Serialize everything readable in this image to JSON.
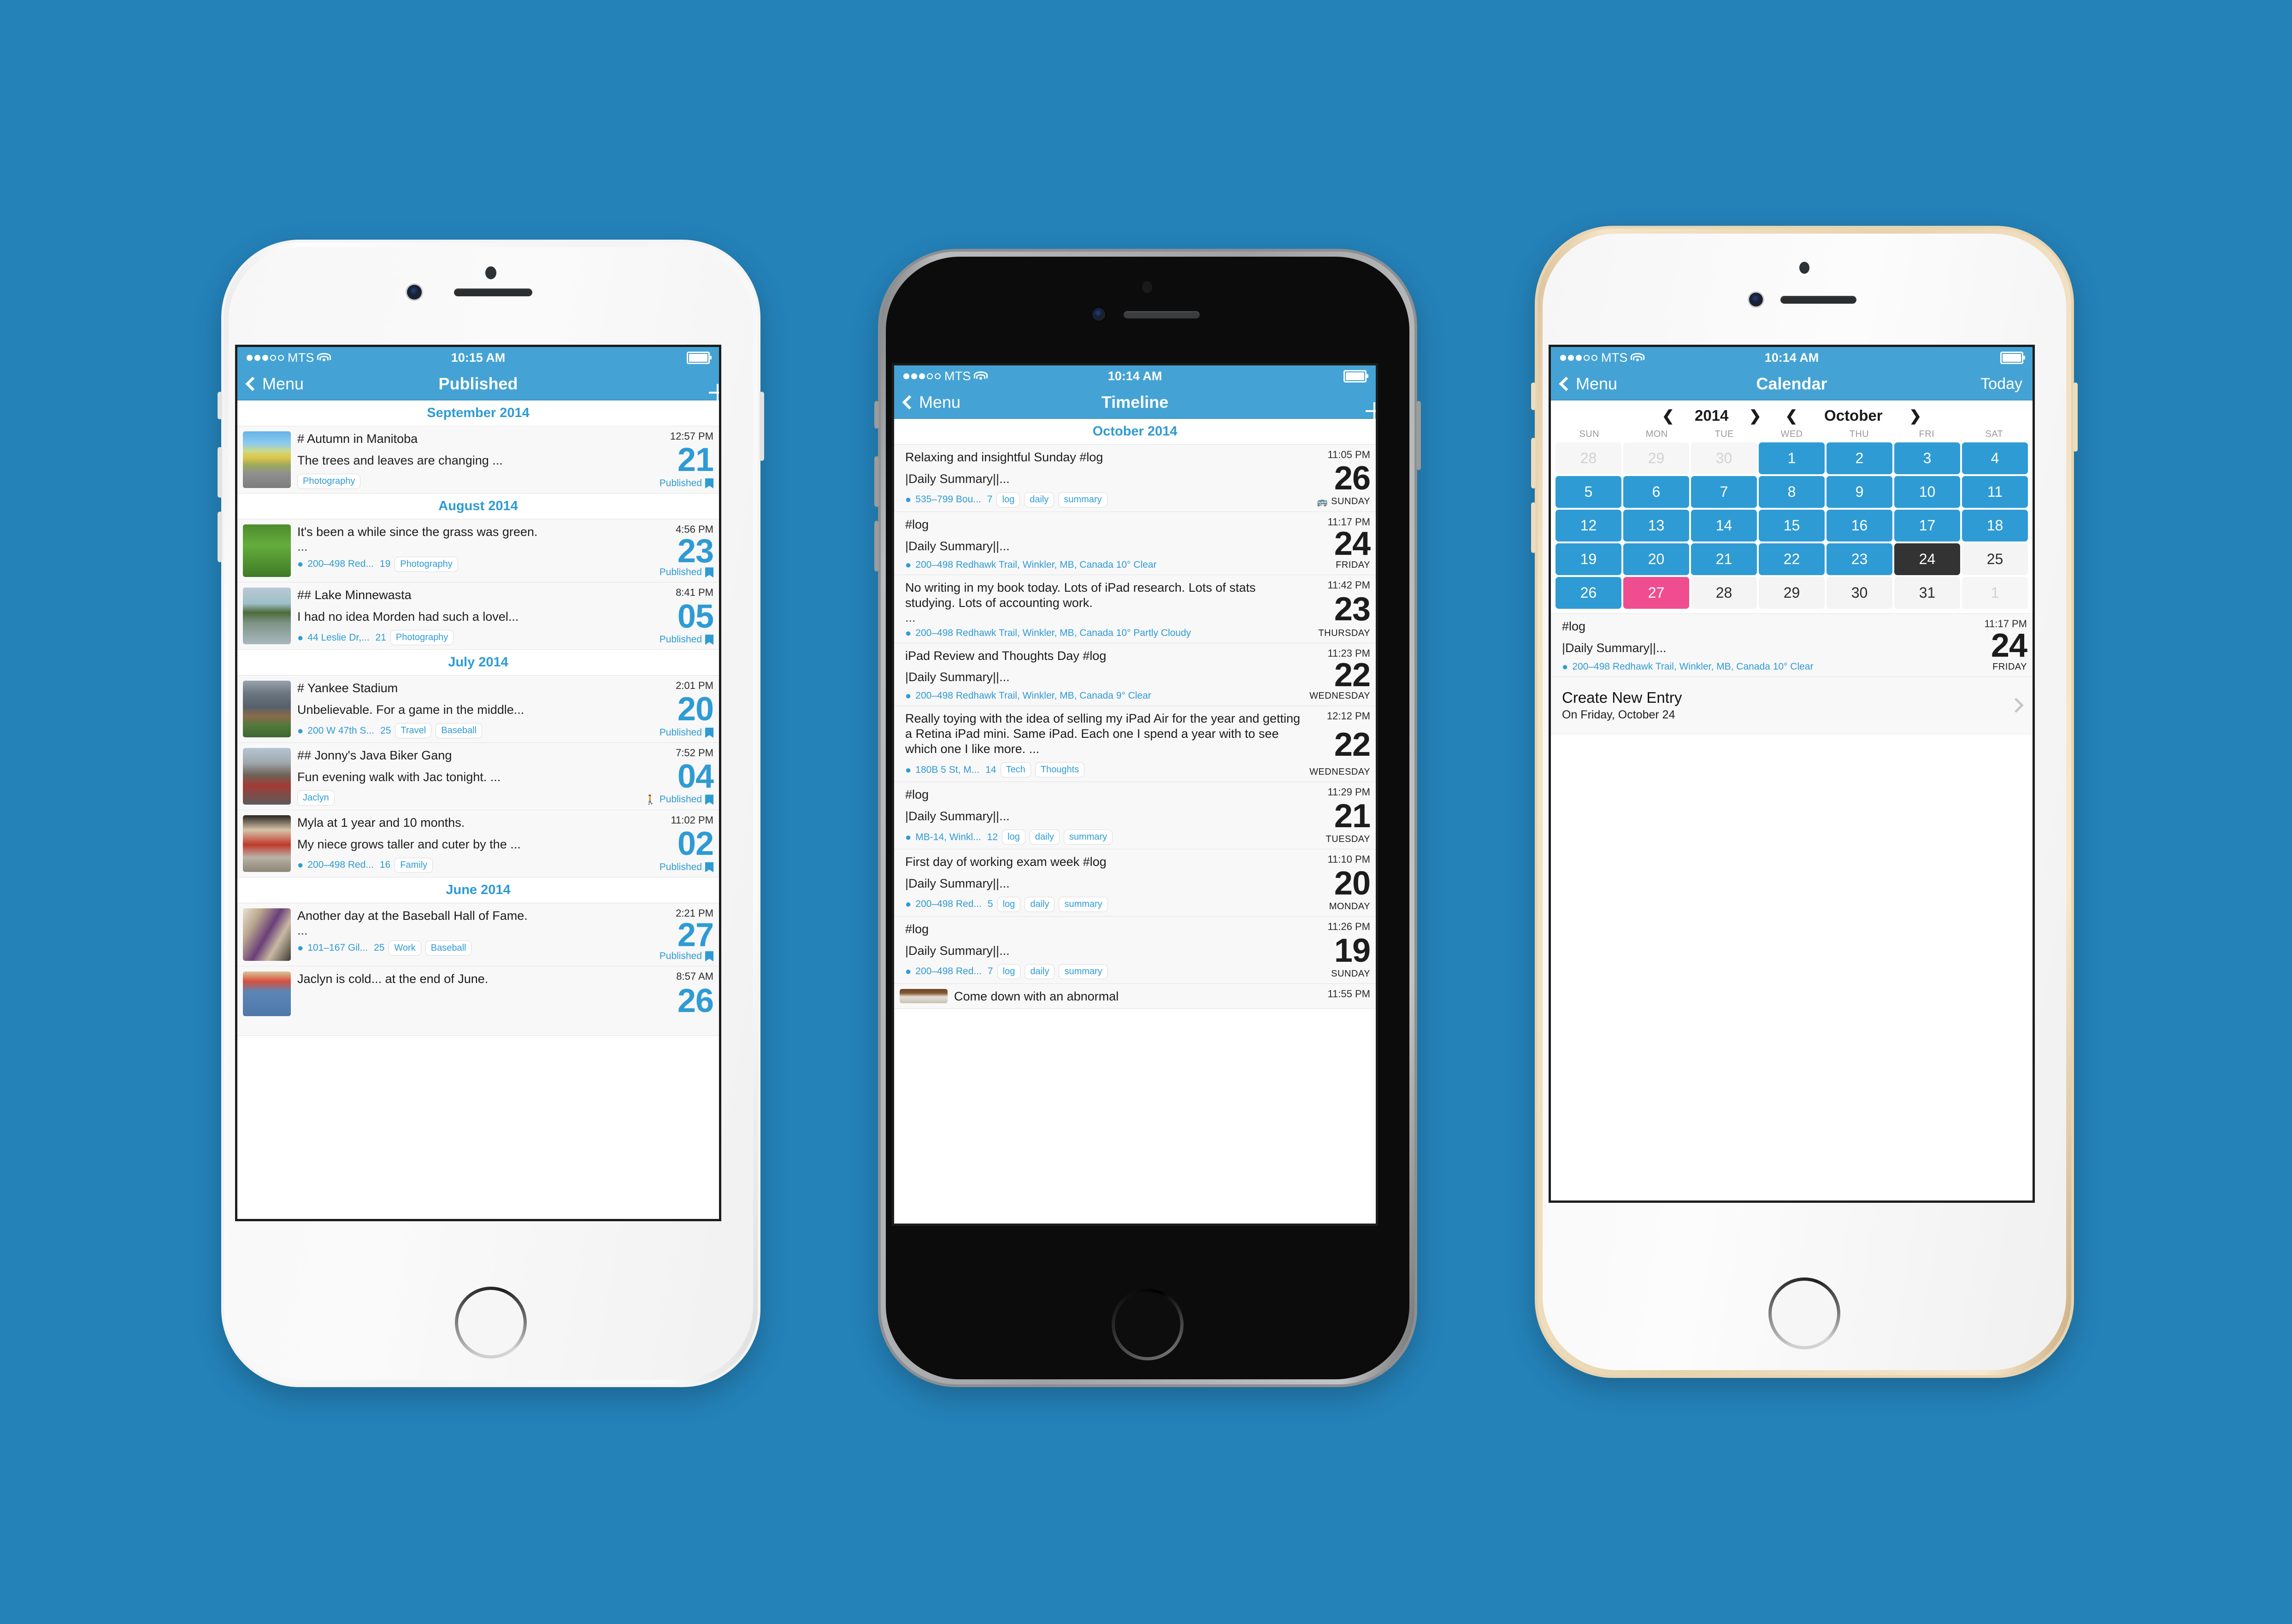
{
  "background_color": "#2482b9",
  "accent_color": "#2e9bd4",
  "phones": [
    {
      "id": "phone-published",
      "finish": "white",
      "status": {
        "carrier": "MTS",
        "time": "10:15 AM",
        "signal_filled": 3,
        "signal_empty": 2
      },
      "nav": {
        "back_label": "Menu",
        "title": "Published",
        "right_icon": "plus-icon"
      },
      "sections": [
        {
          "month": "September 2014",
          "entries": [
            {
              "title": "# Autumn in Manitoba",
              "snippet": "The trees and leaves are changing ...",
              "ellipsis": false,
              "location": "",
              "count": "",
              "tags": [
                "Photography"
              ],
              "time": "12:57 PM",
              "day": "21",
              "status": "Published",
              "thumb": "autumn-street-trees",
              "walking": false
            }
          ]
        },
        {
          "month": "August 2014",
          "entries": [
            {
              "title": "It's been a while since the grass was green.",
              "snippet": "",
              "ellipsis": true,
              "location": "200–498 Red...",
              "count": "19",
              "tags": [
                "Photography"
              ],
              "time": "4:56 PM",
              "day": "23",
              "status": "Published",
              "thumb": "green-grass",
              "walking": false
            },
            {
              "title": "## Lake Minnewasta",
              "snippet": "I had no idea Morden had such a lovel...",
              "ellipsis": false,
              "location": "44 Leslie Dr,...",
              "count": "21",
              "tags": [
                "Photography"
              ],
              "time": "8:41 PM",
              "day": "05",
              "status": "Published",
              "thumb": "lake-shore",
              "walking": false
            }
          ]
        },
        {
          "month": "July 2014",
          "entries": [
            {
              "title": "# Yankee Stadium",
              "snippet": "Unbelievable. For a game in the middle...",
              "ellipsis": false,
              "location": "200 W 47th S...",
              "count": "25",
              "tags": [
                "Travel",
                "Baseball"
              ],
              "time": "2:01 PM",
              "day": "20",
              "status": "Published",
              "thumb": "baseball-stadium",
              "walking": false
            },
            {
              "title": "## Jonny's Java Biker Gang",
              "snippet": "Fun evening walk with Jac tonight. ...",
              "ellipsis": false,
              "location": "",
              "count": "",
              "tags": [
                "Jaclyn"
              ],
              "time": "7:52 PM",
              "day": "04",
              "status": "Published",
              "thumb": "motorcycles-street",
              "walking": true
            },
            {
              "title": "Myla at 1 year and 10 months.",
              "snippet": "My niece grows taller and cuter by the ...",
              "ellipsis": false,
              "location": "200–498 Red...",
              "count": "16",
              "tags": [
                "Family"
              ],
              "time": "11:02 PM",
              "day": "02",
              "status": "Published",
              "thumb": "toddler-red-shirt",
              "walking": false
            }
          ]
        },
        {
          "month": "June 2014",
          "entries": [
            {
              "title": "Another day at the Baseball Hall of Fame.",
              "snippet": "",
              "ellipsis": true,
              "location": "101–167 Gil...",
              "count": "25",
              "tags": [
                "Work",
                "Baseball"
              ],
              "time": "2:21 PM",
              "day": "27",
              "status": "Published",
              "thumb": "jersey-rack",
              "walking": false
            },
            {
              "title": "Jaclyn is cold... at the end of June.",
              "snippet": "",
              "ellipsis": false,
              "location": "",
              "count": "",
              "tags": [],
              "time": "8:57 AM",
              "day": "26",
              "status": "",
              "thumb": "girl-denim-jacket",
              "walking": false
            }
          ]
        }
      ]
    },
    {
      "id": "phone-timeline",
      "finish": "black",
      "status": {
        "carrier": "MTS",
        "time": "10:14 AM",
        "signal_filled": 3,
        "signal_empty": 2
      },
      "nav": {
        "back_label": "Menu",
        "title": "Timeline",
        "right_icon": "plus-icon"
      },
      "sections": [
        {
          "month": "October 2014",
          "entries": [
            {
              "title": "Relaxing and insightful Sunday  #log",
              "snippet": "|Daily Summary||...",
              "ellipsis": false,
              "location": "535–799 Bou...",
              "count": "7",
              "tags": [
                "log",
                "daily",
                "summary"
              ],
              "time": "11:05 PM",
              "day": "26",
              "weekday": "SUNDAY",
              "train": true,
              "thumb": ""
            },
            {
              "title": "#log",
              "snippet": "|Daily Summary||...",
              "ellipsis": false,
              "location": "200–498 Redhawk Trail, Winkler, MB, Canada 10° Clear",
              "count": "",
              "tags": [],
              "time": "11:17 PM",
              "day": "24",
              "weekday": "FRIDAY",
              "train": false,
              "thumb": ""
            },
            {
              "title": "No writing in my book today. Lots of iPad research. Lots of stats studying. Lots of accounting work.",
              "snippet": "",
              "ellipsis": true,
              "location": "200–498 Redhawk Trail, Winkler, MB, Canada 10° Partly Cloudy",
              "count": "",
              "tags": [],
              "time": "11:42 PM",
              "day": "23",
              "weekday": "THURSDAY",
              "train": false,
              "thumb": ""
            },
            {
              "title": "iPad Review and Thoughts Day #log",
              "snippet": "|Daily Summary||...",
              "ellipsis": false,
              "location": "200–498 Redhawk Trail, Winkler, MB, Canada 9° Clear",
              "count": "",
              "tags": [],
              "time": "11:23 PM",
              "day": "22",
              "weekday": "WEDNESDAY",
              "train": false,
              "thumb": ""
            },
            {
              "title": "Really toying with the idea of selling my iPad Air for the year and getting a Retina iPad mini. Same iPad. Each one I spend a year with to see which one I like more. ...",
              "snippet": "",
              "ellipsis": false,
              "location": "180B 5 St, M...",
              "count": "14",
              "tags": [
                "Tech",
                "Thoughts"
              ],
              "time": "12:12 PM",
              "day": "22",
              "weekday": "WEDNESDAY",
              "train": false,
              "thumb": ""
            },
            {
              "title": "#log",
              "snippet": "|Daily Summary||...",
              "ellipsis": false,
              "location": "MB-14, Winkl...",
              "count": "12",
              "tags": [
                "log",
                "daily",
                "summary"
              ],
              "time": "11:29 PM",
              "day": "21",
              "weekday": "TUESDAY",
              "train": false,
              "thumb": ""
            },
            {
              "title": "First day of working exam week #log",
              "snippet": "|Daily Summary||...",
              "ellipsis": false,
              "location": "200–498 Red...",
              "count": "5",
              "tags": [
                "log",
                "daily",
                "summary"
              ],
              "time": "11:10 PM",
              "day": "20",
              "weekday": "MONDAY",
              "train": false,
              "thumb": ""
            },
            {
              "title": "#log",
              "snippet": "|Daily Summary||...",
              "ellipsis": false,
              "location": "200–498 Red...",
              "count": "7",
              "tags": [
                "log",
                "daily",
                "summary"
              ],
              "time": "11:26 PM",
              "day": "19",
              "weekday": "SUNDAY",
              "train": false,
              "thumb": ""
            },
            {
              "title": "Come down with an abnormal",
              "snippet": "",
              "ellipsis": false,
              "location": "",
              "count": "",
              "tags": [],
              "time": "11:55 PM",
              "day": "",
              "weekday": "",
              "train": false,
              "thumb": "desk-papers"
            }
          ]
        }
      ]
    },
    {
      "id": "phone-calendar",
      "finish": "gold",
      "status": {
        "carrier": "MTS",
        "time": "10:14 AM",
        "signal_filled": 3,
        "signal_empty": 2
      },
      "nav": {
        "back_label": "Menu",
        "title": "Calendar",
        "right_label": "Today"
      },
      "calendar": {
        "year": "2014",
        "month": "October",
        "prev_year_icon": "chevron-left-icon",
        "next_year_icon": "chevron-right-icon",
        "prev_month_icon": "chevron-left-icon",
        "next_month_icon": "chevron-right-icon",
        "weekdays": [
          "SUN",
          "MON",
          "TUE",
          "WED",
          "THU",
          "FRI",
          "SAT"
        ],
        "cells": [
          {
            "n": "28",
            "state": "other"
          },
          {
            "n": "29",
            "state": "other"
          },
          {
            "n": "30",
            "state": "other"
          },
          {
            "n": "1",
            "state": "filled"
          },
          {
            "n": "2",
            "state": "filled"
          },
          {
            "n": "3",
            "state": "filled"
          },
          {
            "n": "4",
            "state": "filled"
          },
          {
            "n": "5",
            "state": "filled"
          },
          {
            "n": "6",
            "state": "filled"
          },
          {
            "n": "7",
            "state": "filled"
          },
          {
            "n": "8",
            "state": "filled"
          },
          {
            "n": "9",
            "state": "filled"
          },
          {
            "n": "10",
            "state": "filled"
          },
          {
            "n": "11",
            "state": "filled"
          },
          {
            "n": "12",
            "state": "filled"
          },
          {
            "n": "13",
            "state": "filled"
          },
          {
            "n": "14",
            "state": "filled"
          },
          {
            "n": "15",
            "state": "filled"
          },
          {
            "n": "16",
            "state": "filled"
          },
          {
            "n": "17",
            "state": "filled"
          },
          {
            "n": "18",
            "state": "filled"
          },
          {
            "n": "19",
            "state": "filled"
          },
          {
            "n": "20",
            "state": "filled"
          },
          {
            "n": "21",
            "state": "filled"
          },
          {
            "n": "22",
            "state": "filled"
          },
          {
            "n": "23",
            "state": "filled"
          },
          {
            "n": "24",
            "state": "today"
          },
          {
            "n": "25",
            "state": "empty"
          },
          {
            "n": "26",
            "state": "filled"
          },
          {
            "n": "27",
            "state": "sel"
          },
          {
            "n": "28",
            "state": "empty"
          },
          {
            "n": "29",
            "state": "empty"
          },
          {
            "n": "30",
            "state": "empty"
          },
          {
            "n": "31",
            "state": "empty"
          },
          {
            "n": "1",
            "state": "other"
          }
        ]
      },
      "day_entry": {
        "title": "#log",
        "snippet": "|Daily Summary||...",
        "location": "200–498 Redhawk Trail, Winkler, MB, Canada 10° Clear",
        "time": "11:17 PM",
        "day": "24",
        "weekday": "FRIDAY"
      },
      "create": {
        "title": "Create New Entry",
        "subtitle": "On Friday, October 24",
        "chevron_icon": "chevron-right-icon"
      }
    }
  ]
}
